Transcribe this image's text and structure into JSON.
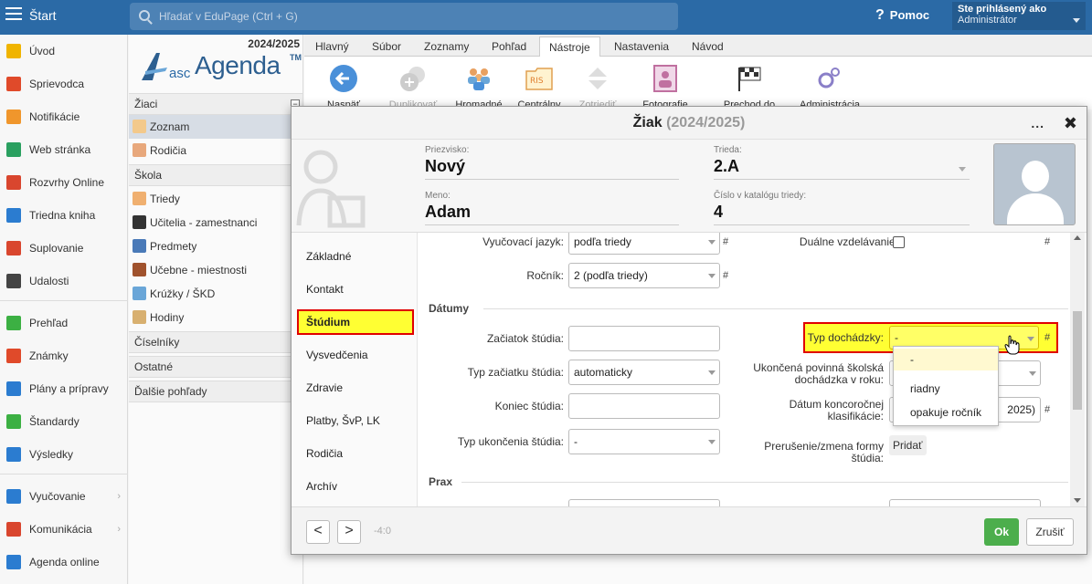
{
  "topbar": {
    "start_label": "Štart",
    "search_placeholder": "Hľadať v EduPage (Ctrl + G)",
    "help_label": "Pomoc",
    "user_line1": "Ste prihlásený ako",
    "user_line2": "Administrátor"
  },
  "leftnav": {
    "items": [
      {
        "label": "Úvod",
        "icon": "star-icon",
        "color": "#f0b400"
      },
      {
        "label": "Sprievodca",
        "icon": "wand-icon",
        "color": "#e04a2a"
      },
      {
        "label": "Notifikácie",
        "icon": "envelope-icon",
        "color": "#f0962c"
      },
      {
        "label": "Web stránka",
        "icon": "house-icon",
        "color": "#2aa060"
      },
      {
        "label": "Rozvrhy Online",
        "icon": "grid-icon",
        "color": "#d9462e"
      },
      {
        "label": "Triedna kniha",
        "icon": "book-icon",
        "color": "#2b7cd0"
      },
      {
        "label": "Suplovanie",
        "icon": "person-icon",
        "color": "#d9462e"
      },
      {
        "label": "Udalosti",
        "icon": "calendar-icon",
        "color": "#444444"
      },
      {
        "label": "Prehľad",
        "icon": "check-circle-icon",
        "color": "#3cb043"
      },
      {
        "label": "Známky",
        "icon": "chart-circle-icon",
        "color": "#e04a2a"
      },
      {
        "label": "Plány a prípravy",
        "icon": "briefcase-icon",
        "color": "#2b7cd0"
      },
      {
        "label": "Štandardy",
        "icon": "shield-icon",
        "color": "#3cb043"
      },
      {
        "label": "Výsledky",
        "icon": "bars-icon",
        "color": "#2b7cd0"
      },
      {
        "label": "Vyučovanie",
        "icon": "open-book-icon",
        "color": "#2b7cd0"
      },
      {
        "label": "Komunikácia",
        "icon": "chat-icon",
        "color": "#d9462e"
      },
      {
        "label": "Agenda online",
        "icon": "pen-icon",
        "color": "#2b7cd0"
      }
    ]
  },
  "subnav": {
    "year": "2024/2025",
    "logo_asc": "asc",
    "logo_agenda": "Agenda",
    "logo_tm": "TM",
    "groups": {
      "ziaci": "Žiaci",
      "skola": "Škola",
      "ciselniky": "Číselníky",
      "ostatne": "Ostatné",
      "dalsie": "Ďalšie pohľady"
    },
    "toggle_minus": "−",
    "toggle_plus": "+",
    "items": {
      "zoznam": "Zoznam",
      "rodicia": "Rodičia",
      "triedy": "Triedy",
      "ucitelia": "Učitelia - zamestnanci",
      "predmety": "Predmety",
      "ucebne": "Učebne - miestnosti",
      "kruzky": "Krúžky / ŠKD",
      "hodiny": "Hodiny"
    }
  },
  "tabs": [
    "Hlavný",
    "Súbor",
    "Zoznamy",
    "Pohľad",
    "Nástroje",
    "Nastavenia",
    "Návod"
  ],
  "ribbon": {
    "naspat": "Naspäť",
    "duplikovat": "Duplikovať",
    "hromadne": "Hromadné",
    "centralny": "Centrálny",
    "zotriedit": "Zotriediť",
    "fotografie": "Fotografie",
    "prechod": "Prechod do",
    "administracia": "Administrácia",
    "ris_text": "RIS"
  },
  "dialog": {
    "title": "Žiak",
    "year": "(2024/2025)",
    "dots": "...",
    "close": "✖",
    "priezvisko_label": "Priezvisko:",
    "priezvisko": "Nový",
    "meno_label": "Meno:",
    "meno": "Adam",
    "trieda_label": "Trieda:",
    "trieda": "2.A",
    "cislo_label": "Číslo v katalógu triedy:",
    "cislo": "4"
  },
  "side": [
    "Základné",
    "Kontakt",
    "Štúdium",
    "Vysvedčenia",
    "Zdravie",
    "Platby, ŠvP, LK",
    "Rodičia",
    "Archív"
  ],
  "form": {
    "hash": "#",
    "vyucovaci_jazyk_label": "Vyučovací jazyk:",
    "vyucovaci_jazyk": "podľa triedy",
    "rocnik_label": "Ročník:",
    "rocnik": "2 (podľa triedy)",
    "dualne_label": "Duálne vzdelávanie:",
    "datumy": "Dátumy",
    "zaciatok_label": "Začiatok štúdia:",
    "zaciatok": "",
    "typ_zaciatku_label": "Typ začiatku štúdia:",
    "typ_zaciatku": "automaticky",
    "koniec_label": "Koniec štúdia:",
    "koniec": "",
    "typ_ukoncenia_label": "Typ ukončenia štúdia:",
    "typ_ukoncenia": "-",
    "typ_dochadzky_label": "Typ dochádzky:",
    "typ_dochadzky": "-",
    "ukoncena_label_1": "Ukončená povinná školská",
    "ukoncena_label_2": "dochádzka v roku:",
    "datum_konc_label_1": "Dátum koncoročnej",
    "datum_konc_label_2": "klasifikácie:",
    "datum_konc_partial": "2025)",
    "prerusenie_label_1": "Prerušenie/zmena formy",
    "prerusenie_label_2": "štúdia:",
    "pridat": "Pridať",
    "prax": "Prax"
  },
  "dropdown": {
    "options": [
      "-",
      "riadny",
      "opakuje ročník"
    ]
  },
  "footer": {
    "prev": "<",
    "next": ">",
    "counter": "-4:0",
    "ok": "Ok",
    "cancel": "Zrušiť"
  }
}
